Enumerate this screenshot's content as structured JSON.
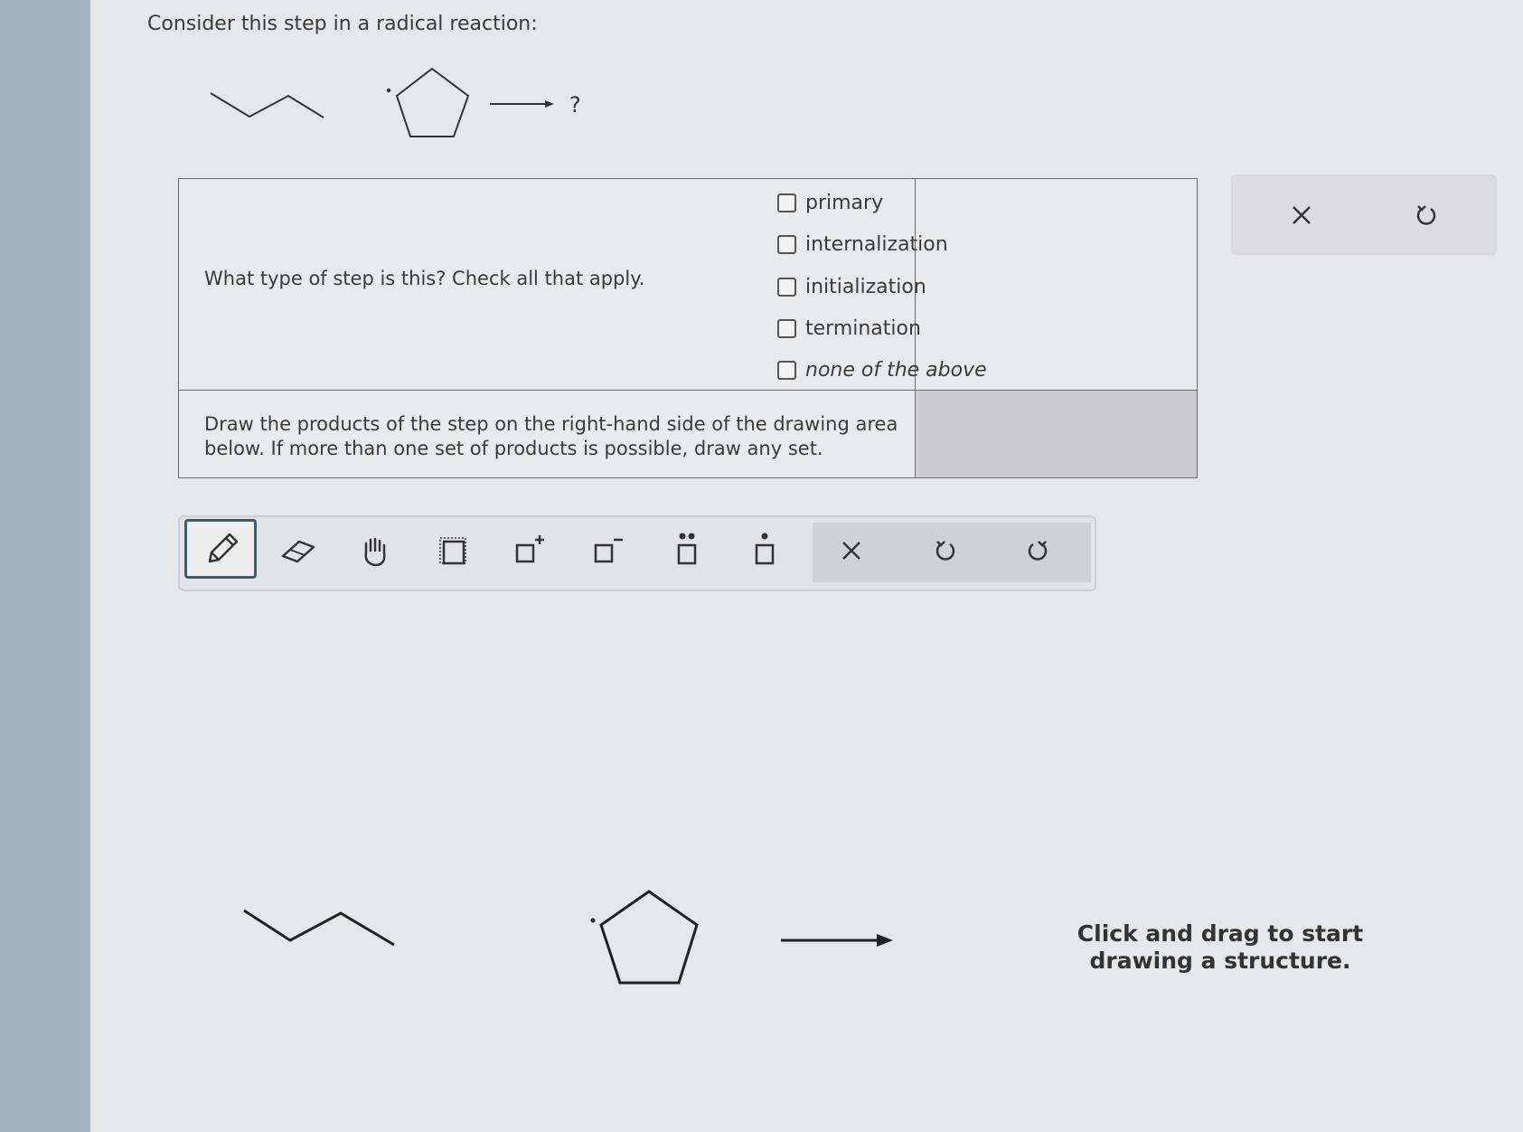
{
  "intro": "Consider this step in a radical reaction:",
  "reaction_question_mark": "?",
  "question1": "What type of step is this? Check all that apply.",
  "options": [
    {
      "label": "primary",
      "checked": false,
      "italic": false
    },
    {
      "label": "internalization",
      "checked": false,
      "italic": false
    },
    {
      "label": "initialization",
      "checked": false,
      "italic": false
    },
    {
      "label": "termination",
      "checked": false,
      "italic": false
    },
    {
      "label": "none of the above",
      "checked": false,
      "italic": true
    }
  ],
  "question2": "Draw the products of the step on the right-hand side of the drawing area below. If more than one set of products is possible, draw any set.",
  "panel": {
    "clear_icon": "close-icon",
    "undo_icon": "undo-icon"
  },
  "toolbar": {
    "tools": [
      "pencil-icon",
      "eraser-icon",
      "hand-icon",
      "select-box-icon",
      "positive-charge-icon",
      "negative-charge-icon",
      "lone-pair-icon",
      "radical-icon",
      "clear-icon",
      "undo-icon",
      "redo-icon"
    ],
    "active_tool": "pencil-icon"
  },
  "canvas_hint_line1": "Click and drag to start",
  "canvas_hint_line2": "drawing a structure.",
  "colors": {
    "accent": "#3b5b6e",
    "left_bar": "#9fb3c2",
    "background": "#e6e7e8"
  }
}
